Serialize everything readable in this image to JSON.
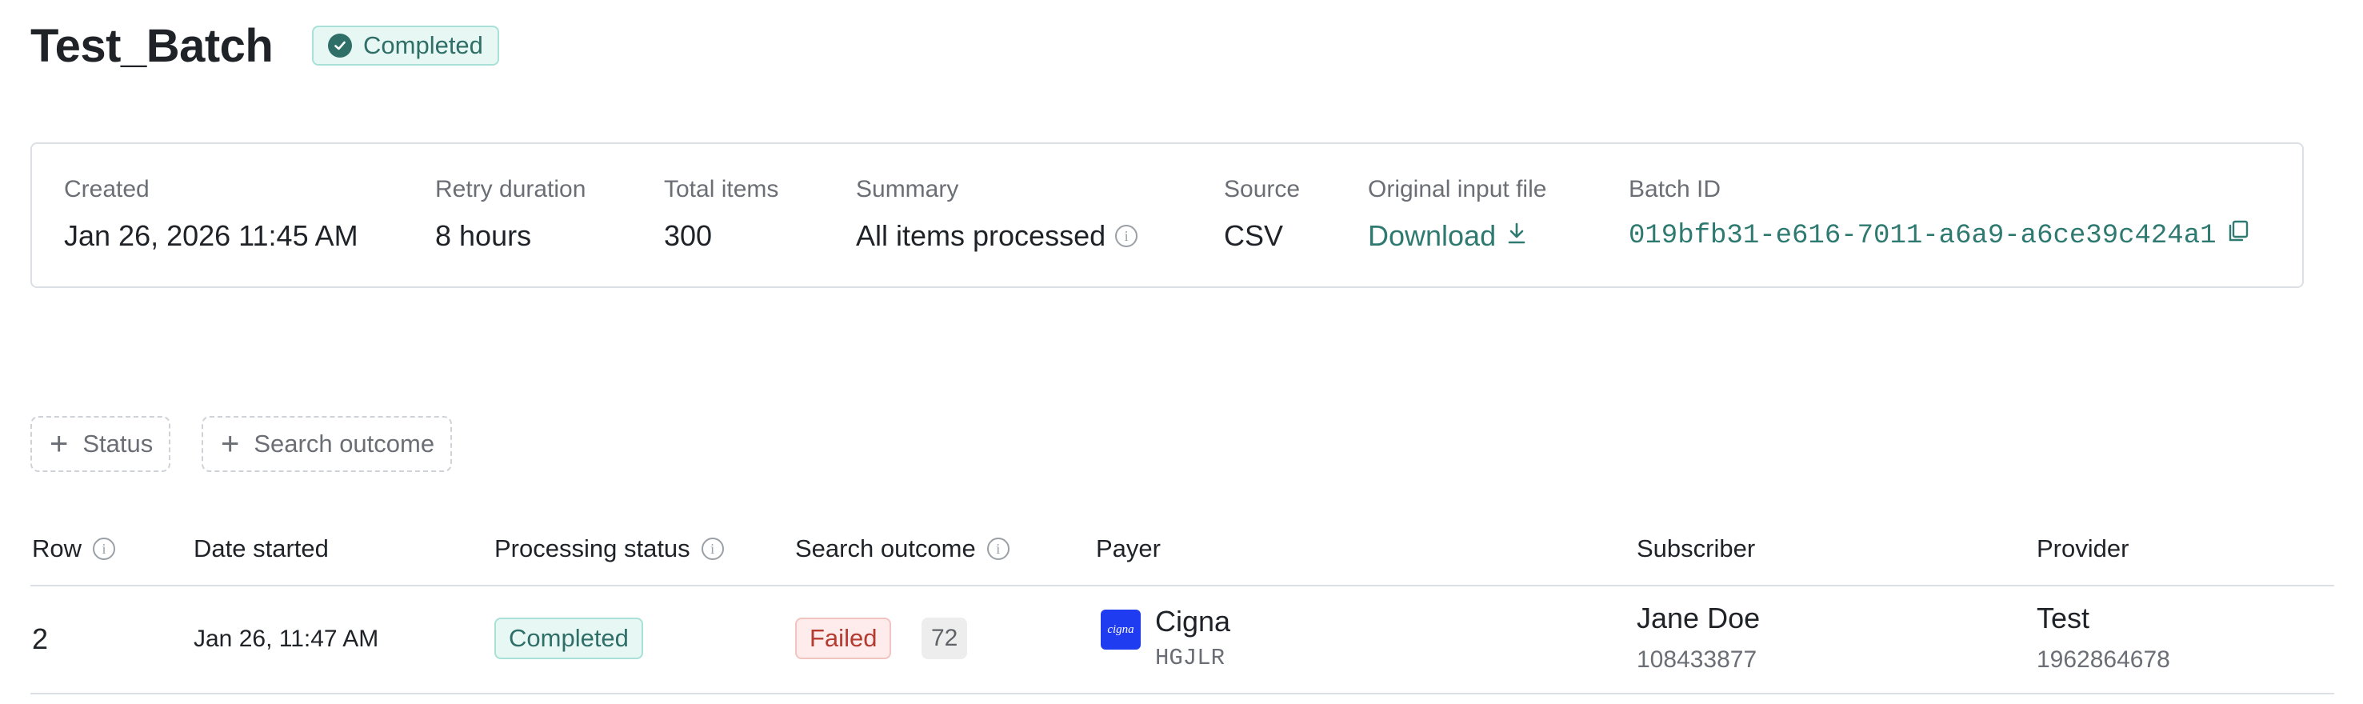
{
  "header": {
    "title": "Test_Batch",
    "status_badge": "Completed"
  },
  "info": {
    "created": {
      "label": "Created",
      "value": "Jan 26, 2026 11:45 AM"
    },
    "retry_duration": {
      "label": "Retry duration",
      "value": "8 hours"
    },
    "total_items": {
      "label": "Total items",
      "value": "300"
    },
    "summary": {
      "label": "Summary",
      "value": "All items processed"
    },
    "source": {
      "label": "Source",
      "value": "CSV"
    },
    "original_input_file": {
      "label": "Original input file",
      "value": "Download"
    },
    "batch_id": {
      "label": "Batch ID",
      "value": "019bfb31-e616-7011-a6a9-a6ce39c424a1"
    }
  },
  "filters": [
    {
      "label": "Status"
    },
    {
      "label": "Search outcome"
    }
  ],
  "table": {
    "columns": [
      "Row",
      "Date started",
      "Processing status",
      "Search outcome",
      "Payer",
      "Subscriber",
      "Provider"
    ],
    "rows": [
      {
        "row": "2",
        "date_started": "Jan 26, 11:47 AM",
        "processing_status": "Completed",
        "search_outcome": "Failed",
        "search_outcome_count": "72",
        "payer_name": "Cigna",
        "payer_logo_text": "cigna",
        "payer_code": "HGJLR",
        "subscriber_name": "Jane Doe",
        "subscriber_id": "108433877",
        "provider_name": "Test",
        "provider_id": "1962864678"
      }
    ]
  },
  "colors": {
    "accent": "#2f7a70",
    "success_bg": "#e7f7f4",
    "failed_text": "#b53a2f"
  }
}
